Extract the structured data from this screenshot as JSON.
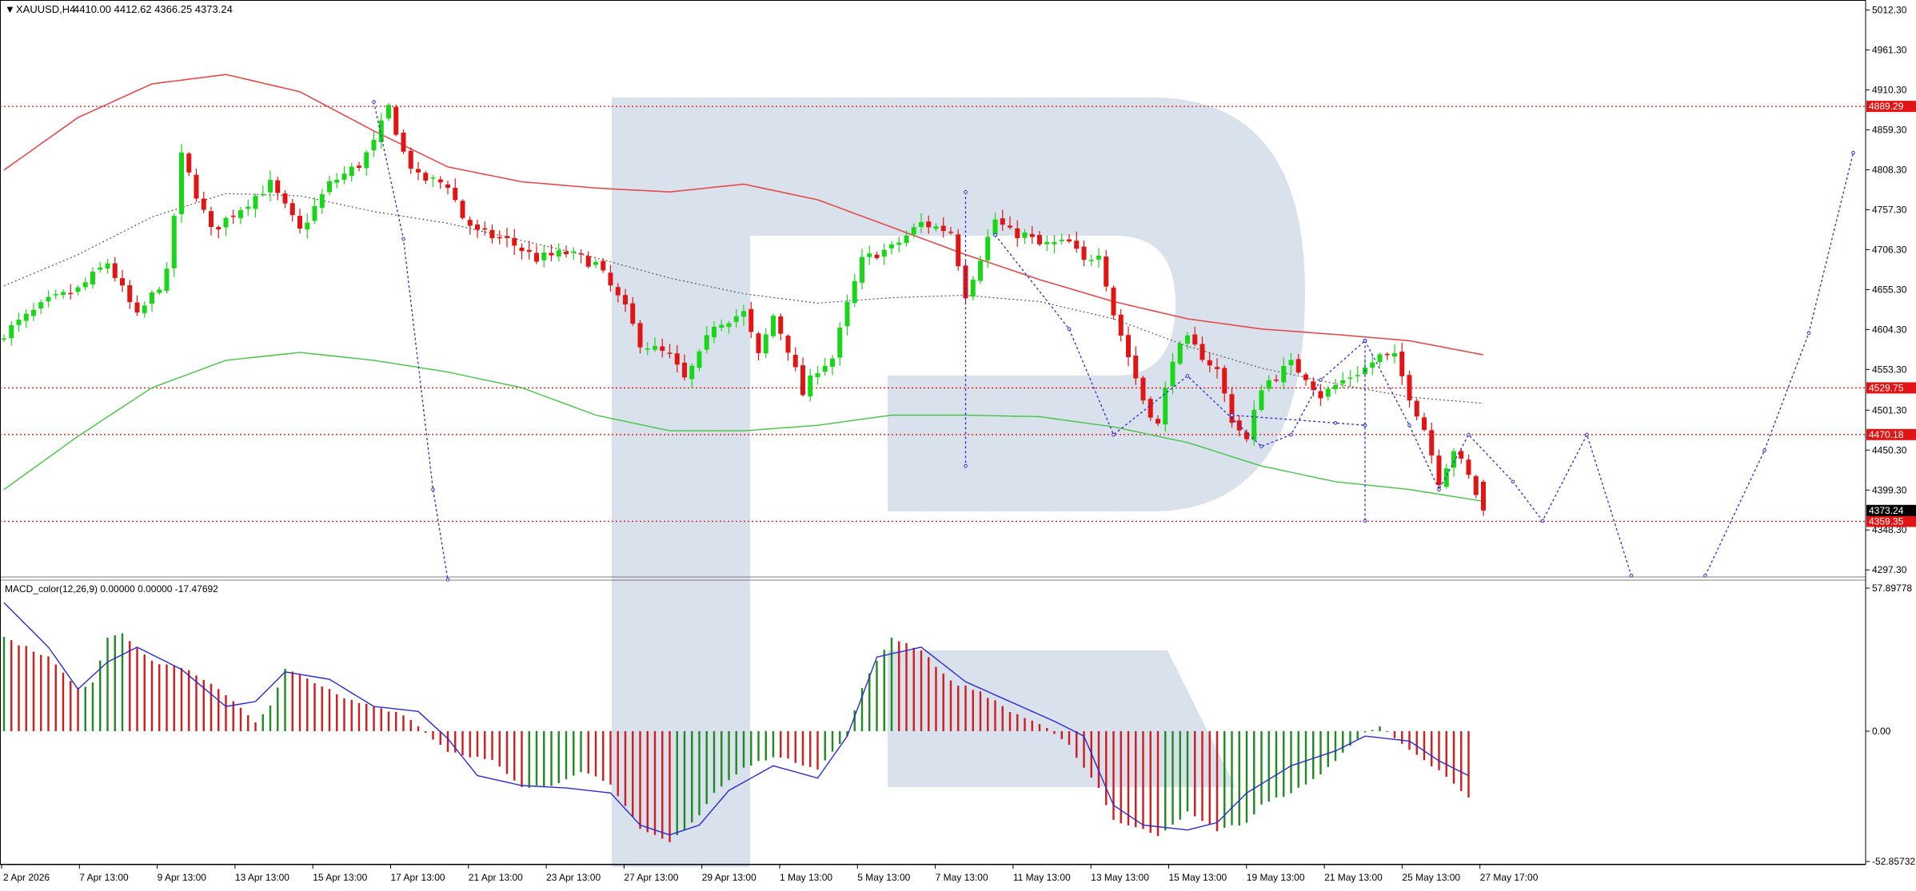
{
  "header": {
    "symbol_label": "XAUUSD,H4",
    "ohlc_text": "4410.00 4412.62 4366.25 4373.24"
  },
  "macd_header": {
    "label": "MACD_color(12,26,9) 0.00000 0.00000 -17.47692"
  },
  "colors": {
    "bull": "#19d619",
    "bear": "#e21414",
    "ma_red": "#e64a4a",
    "ma_green": "#43c443",
    "ma_dotted": "#555555",
    "forecast": "#2b2bd0",
    "level_line": "#e21414",
    "macd_pos": "#d41a1a",
    "macd_neg": "#1f8a1f",
    "signal": "#2a2ad8",
    "watermark": "#d8e1ec"
  },
  "chart_data": [
    {
      "type": "candlestick",
      "title": "XAUUSD,H4",
      "y_tick_labels": [
        "5012.30",
        "4961.30",
        "4910.30",
        "4859.30",
        "4808.30",
        "4757.30",
        "4706.30",
        "4655.30",
        "4604.30",
        "4553.30",
        "4501.30",
        "4450.30",
        "4399.30",
        "4348.30",
        "4297.30"
      ],
      "ylim": [
        4286,
        5020
      ],
      "x_labels": [
        "2 Apr 2026",
        "7 Apr 13:00",
        "9 Apr 13:00",
        "13 Apr 13:00",
        "15 Apr 13:00",
        "17 Apr 13:00",
        "21 Apr 13:00",
        "23 Apr 13:00",
        "27 Apr 13:00",
        "29 Apr 13:00",
        "1 May 13:00",
        "5 May 13:00",
        "7 May 13:00",
        "11 May 13:00",
        "13 May 13:00",
        "15 May 13:00",
        "19 May 13:00",
        "21 May 13:00",
        "25 May 13:00",
        "27 May 17:00"
      ],
      "price_levels": [
        {
          "label": "4889.29",
          "value": 4889.29
        },
        {
          "label": "4529.75",
          "value": 4529.75
        },
        {
          "label": "4470.18",
          "value": 4470.18
        },
        {
          "label": "4359.35",
          "value": 4359.35
        }
      ],
      "current_price": {
        "label": "4373.24",
        "value": 4373.24
      },
      "close_path": [
        [
          0,
          4600
        ],
        [
          6,
          4640
        ],
        [
          10,
          4655
        ],
        [
          14,
          4690
        ],
        [
          18,
          4620
        ],
        [
          22,
          4675
        ],
        [
          24,
          4825
        ],
        [
          28,
          4730
        ],
        [
          32,
          4760
        ],
        [
          36,
          4790
        ],
        [
          40,
          4730
        ],
        [
          44,
          4790
        ],
        [
          48,
          4815
        ],
        [
          50,
          4842
        ],
        [
          52,
          4888
        ],
        [
          54,
          4830
        ],
        [
          56,
          4798
        ],
        [
          60,
          4790
        ],
        [
          62,
          4748
        ],
        [
          64,
          4728
        ],
        [
          68,
          4718
        ],
        [
          72,
          4695
        ],
        [
          76,
          4702
        ],
        [
          80,
          4688
        ],
        [
          84,
          4630
        ],
        [
          86,
          4588
        ],
        [
          90,
          4570
        ],
        [
          92,
          4540
        ],
        [
          94,
          4570
        ],
        [
          96,
          4612
        ],
        [
          100,
          4625
        ],
        [
          102,
          4570
        ],
        [
          104,
          4622
        ],
        [
          106,
          4580
        ],
        [
          108,
          4522
        ],
        [
          110,
          4555
        ],
        [
          112,
          4568
        ],
        [
          114,
          4635
        ],
        [
          116,
          4692
        ],
        [
          118,
          4702
        ],
        [
          120,
          4708
        ],
        [
          124,
          4740
        ],
        [
          128,
          4730
        ],
        [
          130,
          4650
        ],
        [
          134,
          4745
        ],
        [
          136,
          4728
        ],
        [
          138,
          4725
        ],
        [
          140,
          4712
        ],
        [
          144,
          4715
        ],
        [
          146,
          4690
        ],
        [
          148,
          4705
        ],
        [
          150,
          4625
        ],
        [
          154,
          4515
        ],
        [
          156,
          4482
        ],
        [
          158,
          4570
        ],
        [
          160,
          4590
        ],
        [
          164,
          4552
        ],
        [
          166,
          4490
        ],
        [
          168,
          4462
        ],
        [
          170,
          4532
        ],
        [
          174,
          4560
        ],
        [
          176,
          4545
        ],
        [
          178,
          4520
        ],
        [
          182,
          4545
        ],
        [
          184,
          4555
        ],
        [
          186,
          4570
        ],
        [
          188,
          4568
        ],
        [
          190,
          4520
        ],
        [
          192,
          4478
        ],
        [
          194,
          4412
        ],
        [
          196,
          4452
        ],
        [
          198,
          4416
        ],
        [
          200,
          4373
        ]
      ],
      "ma_red": [
        [
          0,
          4808
        ],
        [
          10,
          4875
        ],
        [
          20,
          4918
        ],
        [
          30,
          4930
        ],
        [
          40,
          4908
        ],
        [
          50,
          4858
        ],
        [
          60,
          4812
        ],
        [
          70,
          4793
        ],
        [
          80,
          4785
        ],
        [
          90,
          4780
        ],
        [
          100,
          4790
        ],
        [
          110,
          4770
        ],
        [
          120,
          4735
        ],
        [
          130,
          4700
        ],
        [
          140,
          4668
        ],
        [
          150,
          4640
        ],
        [
          160,
          4618
        ],
        [
          170,
          4605
        ],
        [
          180,
          4598
        ],
        [
          190,
          4590
        ],
        [
          200,
          4572
        ]
      ],
      "ma_green": [
        [
          0,
          4400
        ],
        [
          10,
          4468
        ],
        [
          20,
          4530
        ],
        [
          30,
          4565
        ],
        [
          40,
          4575
        ],
        [
          50,
          4565
        ],
        [
          60,
          4550
        ],
        [
          70,
          4530
        ],
        [
          80,
          4495
        ],
        [
          90,
          4475
        ],
        [
          100,
          4475
        ],
        [
          110,
          4482
        ],
        [
          120,
          4495
        ],
        [
          130,
          4495
        ],
        [
          140,
          4493
        ],
        [
          150,
          4480
        ],
        [
          160,
          4460
        ],
        [
          170,
          4430
        ],
        [
          180,
          4410
        ],
        [
          190,
          4400
        ],
        [
          200,
          4385
        ]
      ],
      "ma_dotted": [
        [
          0,
          4660
        ],
        [
          10,
          4700
        ],
        [
          20,
          4748
        ],
        [
          30,
          4778
        ],
        [
          40,
          4775
        ],
        [
          50,
          4755
        ],
        [
          60,
          4740
        ],
        [
          70,
          4718
        ],
        [
          80,
          4696
        ],
        [
          90,
          4670
        ],
        [
          100,
          4650
        ],
        [
          110,
          4638
        ],
        [
          120,
          4645
        ],
        [
          130,
          4648
        ],
        [
          140,
          4640
        ],
        [
          150,
          4618
        ],
        [
          160,
          4583
        ],
        [
          170,
          4555
        ],
        [
          180,
          4535
        ],
        [
          190,
          4518
        ],
        [
          200,
          4510
        ]
      ],
      "forecast": [
        {
          "points": [
            [
              50,
              4895
            ],
            [
              54,
              4720
            ],
            [
              58,
              4400
            ],
            [
              60,
              4285
            ]
          ]
        },
        {
          "points": [
            [
              130,
              4780
            ],
            [
              130,
              4430
            ]
          ]
        },
        {
          "points": [
            [
              134,
              4725
            ],
            [
              144,
              4605
            ],
            [
              150,
              4470
            ],
            [
              160,
              4545
            ],
            [
              170,
              4455
            ],
            [
              174,
              4470
            ],
            [
              178,
              4540
            ],
            [
              184,
              4590
            ]
          ]
        },
        {
          "points": [
            [
              166,
              4495
            ],
            [
              180,
              4485
            ],
            [
              184,
              4482
            ]
          ]
        },
        {
          "points": [
            [
              184,
              4590
            ],
            [
              184,
              4360
            ]
          ]
        },
        {
          "points": [
            [
              184,
              4590
            ],
            [
              190,
              4482
            ],
            [
              194,
              4400
            ],
            [
              198,
              4470
            ],
            [
              204,
              4410
            ],
            [
              208,
              4360
            ],
            [
              214,
              4470
            ],
            [
              220,
              4290
            ]
          ]
        },
        {
          "points": [
            [
              230,
              4290
            ],
            [
              238,
              4450
            ],
            [
              244,
              4600
            ],
            [
              250,
              4830
            ]
          ]
        }
      ]
    },
    {
      "type": "histogram",
      "title": "MACD_color(12,26,9)",
      "y_tick_labels": [
        "57.89778",
        "0.00",
        "-52.85732"
      ],
      "ylim": [
        -52.85732,
        57.89778
      ],
      "hist_path": [
        [
          0,
          38
        ],
        [
          6,
          30
        ],
        [
          10,
          17
        ],
        [
          12,
          20
        ],
        [
          14,
          38
        ],
        [
          16,
          40
        ],
        [
          18,
          34
        ],
        [
          20,
          28
        ],
        [
          24,
          26
        ],
        [
          30,
          15
        ],
        [
          34,
          4
        ],
        [
          36,
          10
        ],
        [
          38,
          25
        ],
        [
          42,
          20
        ],
        [
          46,
          13
        ],
        [
          50,
          10
        ],
        [
          54,
          7
        ],
        [
          58,
          -3
        ],
        [
          60,
          -8
        ],
        [
          66,
          -12
        ],
        [
          70,
          -23
        ],
        [
          74,
          -22
        ],
        [
          78,
          -16
        ],
        [
          82,
          -21
        ],
        [
          86,
          -40
        ],
        [
          90,
          -45
        ],
        [
          94,
          -34
        ],
        [
          96,
          -25
        ],
        [
          100,
          -15
        ],
        [
          104,
          -10
        ],
        [
          110,
          -15
        ],
        [
          114,
          -2
        ],
        [
          116,
          18
        ],
        [
          120,
          38
        ],
        [
          124,
          33
        ],
        [
          128,
          20
        ],
        [
          132,
          16
        ],
        [
          136,
          8
        ],
        [
          140,
          3
        ],
        [
          144,
          -6
        ],
        [
          148,
          -23
        ],
        [
          150,
          -36
        ],
        [
          156,
          -42
        ],
        [
          160,
          -33
        ],
        [
          164,
          -40
        ],
        [
          168,
          -37
        ],
        [
          170,
          -30
        ],
        [
          176,
          -22
        ],
        [
          180,
          -12
        ],
        [
          184,
          0
        ],
        [
          186,
          2
        ],
        [
          190,
          -8
        ],
        [
          194,
          -16
        ],
        [
          198,
          -27
        ]
      ],
      "signal_path": [
        [
          0,
          52
        ],
        [
          6,
          34
        ],
        [
          10,
          17
        ],
        [
          14,
          28
        ],
        [
          18,
          34
        ],
        [
          24,
          25
        ],
        [
          30,
          10
        ],
        [
          34,
          12
        ],
        [
          38,
          24
        ],
        [
          44,
          21
        ],
        [
          50,
          10
        ],
        [
          56,
          8
        ],
        [
          60,
          -3
        ],
        [
          64,
          -18
        ],
        [
          70,
          -22
        ],
        [
          76,
          -23
        ],
        [
          82,
          -25
        ],
        [
          86,
          -38
        ],
        [
          90,
          -42
        ],
        [
          94,
          -38
        ],
        [
          98,
          -24
        ],
        [
          104,
          -14
        ],
        [
          110,
          -19
        ],
        [
          114,
          -2
        ],
        [
          118,
          30
        ],
        [
          124,
          34
        ],
        [
          130,
          20
        ],
        [
          136,
          12
        ],
        [
          142,
          4
        ],
        [
          146,
          -2
        ],
        [
          150,
          -30
        ],
        [
          154,
          -38
        ],
        [
          160,
          -40
        ],
        [
          164,
          -37
        ],
        [
          168,
          -25
        ],
        [
          174,
          -14
        ],
        [
          180,
          -8
        ],
        [
          184,
          -2
        ],
        [
          190,
          -4
        ],
        [
          194,
          -12
        ],
        [
          198,
          -18
        ]
      ]
    }
  ]
}
